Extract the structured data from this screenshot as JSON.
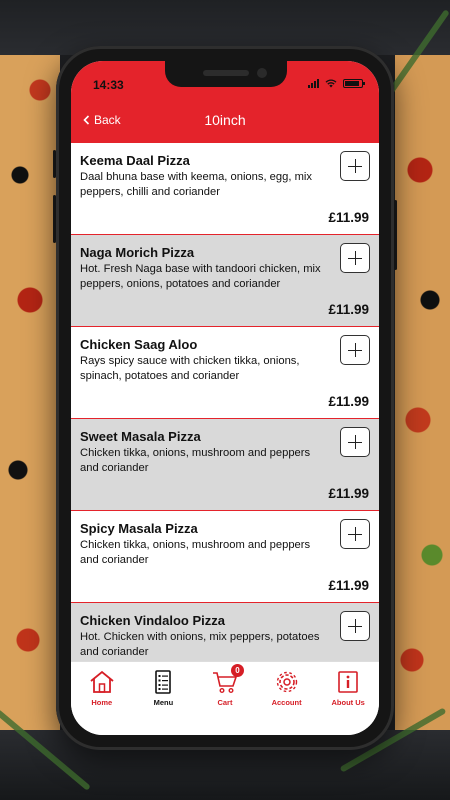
{
  "status": {
    "time": "14:33"
  },
  "nav": {
    "back_label": "Back",
    "title": "10inch"
  },
  "items": [
    {
      "name": "Keema Daal Pizza",
      "description": "Daal bhuna base with keema, onions, egg, mix peppers, chilli and coriander",
      "price": "£11.99"
    },
    {
      "name": "Naga Morich Pizza",
      "description": "Hot. Fresh Naga base with tandoori chicken, mix peppers, onions, potatoes and coriander",
      "price": "£11.99"
    },
    {
      "name": "Chicken Saag Aloo",
      "description": "Rays spicy sauce with chicken tikka, onions, spinach, potatoes and coriander",
      "price": "£11.99"
    },
    {
      "name": "Sweet Masala Pizza",
      "description": "Chicken tikka, onions, mushroom and peppers and coriander",
      "price": "£11.99"
    },
    {
      "name": "Spicy Masala Pizza",
      "description": "Chicken tikka, onions, mushroom and peppers and coriander",
      "price": "£11.99"
    },
    {
      "name": "Chicken Vindaloo Pizza",
      "description": "Hot. Chicken with onions, mix peppers, potatoes and coriander",
      "price": ""
    }
  ],
  "tabs": [
    {
      "label": "Home",
      "icon": "home-icon"
    },
    {
      "label": "Menu",
      "icon": "menu-list-icon"
    },
    {
      "label": "Cart",
      "icon": "cart-icon",
      "badge": "0"
    },
    {
      "label": "Account",
      "icon": "gear-icon"
    },
    {
      "label": "About Us",
      "icon": "info-icon"
    }
  ],
  "colors": {
    "accent": "#e4232b",
    "alt_row": "#d9d9d9",
    "tab_label": "#d61e26"
  }
}
